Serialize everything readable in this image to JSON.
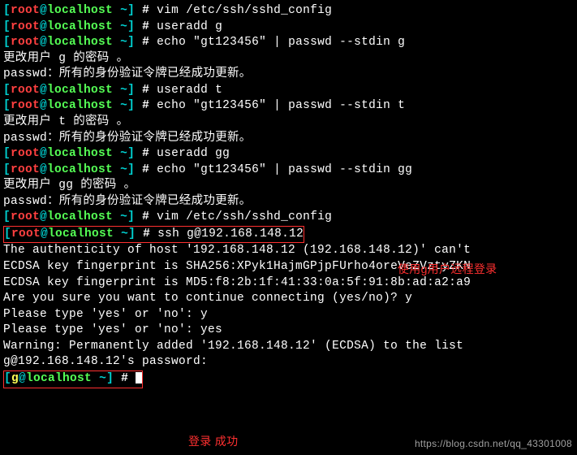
{
  "colors": {
    "red": "#ff4040",
    "green": "#55ff55",
    "cyan": "#00d0d0",
    "yellow": "#ffff55",
    "white": "#ffffff"
  },
  "prompt_root": {
    "open": "[",
    "user": "root",
    "at": "@",
    "host": "localhost",
    "tilde": " ~",
    "close": "]",
    "hash": " # "
  },
  "prompt_g": {
    "open": "[",
    "user": "g",
    "at": "@",
    "host": "localhost",
    "tilde": " ~",
    "close": "]",
    "hash": " # "
  },
  "cmd": {
    "c1": "vim /etc/ssh/sshd_config",
    "c2": "useradd g",
    "c3": "echo \"gt123456\" | passwd --stdin g",
    "c4": "useradd t",
    "c5": "echo \"gt123456\" | passwd --stdin t",
    "c6": "useradd gg",
    "c7": "echo \"gt123456\" | passwd --stdin gg",
    "c8": "vim /etc/ssh/sshd_config",
    "c9": "ssh g@192.168.148.12"
  },
  "out": {
    "chg_g": "更改用户 g 的密码 。",
    "chg_t": "更改用户 t 的密码 。",
    "chg_gg": "更改用户 gg 的密码 。",
    "ok": "passwd：所有的身份验证令牌已经成功更新。",
    "auth": "The authenticity of host '192.168.148.12 (192.168.148.12)' can't",
    "fp1": "ECDSA key fingerprint is SHA256:XPyk1HajmGPjpFUrho4oreVeZVztyZKN",
    "fp2": "ECDSA key fingerprint is MD5:f8:2b:1f:41:33:0a:5f:91:8b:ad:a2:a9",
    "sure": "Are you sure you want to continue connecting (yes/no)? y",
    "pt1": "Please type 'yes' or 'no': y",
    "pt2": "Please type 'yes' or 'no': yes",
    "warn": "Warning: Permanently added '192.168.148.12' (ECDSA) to the list",
    "pw": "g@192.168.148.12's password:"
  },
  "annotations": {
    "a1": "使用g用户远程登录",
    "a2": "登录 成功"
  },
  "watermark": "https://blog.csdn.net/qq_43301008"
}
